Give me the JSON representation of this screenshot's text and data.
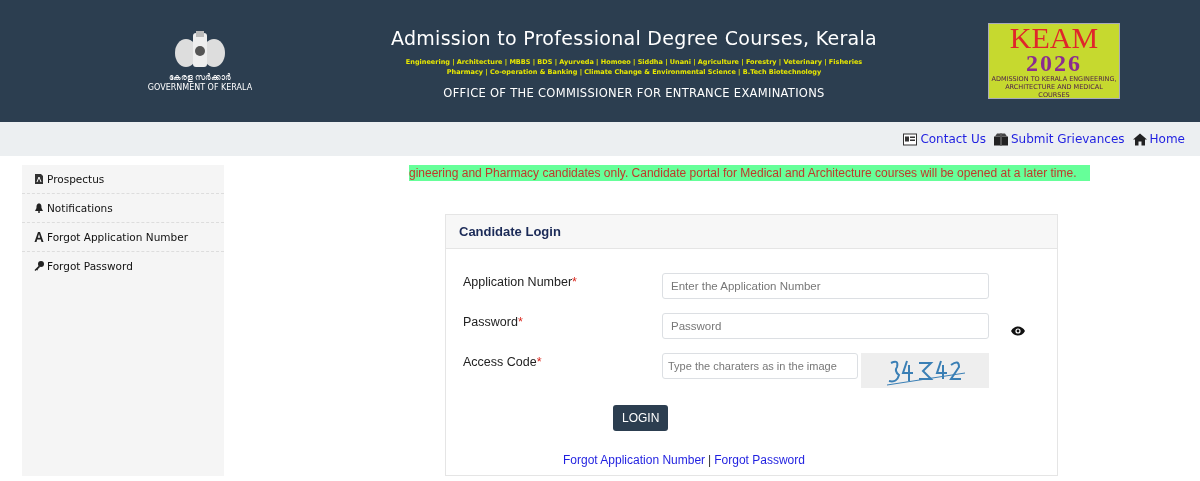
{
  "header": {
    "emblem_caption_ml": "കേരള സർക്കാർ",
    "emblem_caption": "GOVERNMENT OF KERALA",
    "title": "Admission to Professional Degree Courses, Kerala",
    "courses_line_1": "Engineering | Architecture | MBBS | BDS | Ayurveda | Homoeo | Siddha | Unani | Agriculture | Forestry | Veterinary | Fisheries",
    "courses_line_2": "Pharmacy | Co-operation & Banking | Climate Change & Environmental Science | B.Tech Biotechnology",
    "subtitle": "OFFICE OF THE COMMISSIONER FOR ENTRANCE EXAMINATIONS",
    "logo": {
      "name": "KEAM",
      "year": "2026",
      "caption": "ADMISSION TO KERALA ENGINEERING, ARCHITECTURE AND MEDICAL COURSES"
    }
  },
  "nav_links": [
    {
      "label": "Contact Us",
      "kind": "card"
    },
    {
      "label": "Submit Grievances",
      "kind": "box"
    },
    {
      "label": "Home",
      "kind": "home"
    }
  ],
  "sidebar": {
    "items": [
      {
        "label": "Prospectus",
        "kind": "doc"
      },
      {
        "label": "Notifications",
        "kind": "bell"
      },
      {
        "label": "Forgot Application Number",
        "kind": "letter"
      },
      {
        "label": "Forgot Password",
        "kind": "key"
      }
    ]
  },
  "marquee": "gineering and Pharmacy candidates only. Candidate portal for Medical and Architecture courses will be opened at a later time.",
  "login": {
    "title": "Candidate Login",
    "fields": [
      {
        "label": "Application Number",
        "required_mark": "*",
        "placeholder": "Enter the Application Number",
        "kind": "text"
      },
      {
        "label": "Password",
        "required_mark": "*",
        "placeholder": "Password",
        "kind": "password"
      },
      {
        "label": "Access Code",
        "required_mark": "*",
        "placeholder": "Type the charaters as in the image",
        "kind": "captcha"
      }
    ],
    "button": "LOGIN",
    "links": [
      {
        "label": "Forgot Application Number"
      },
      {
        "separator": "|",
        "label": "Forgot Password"
      }
    ]
  }
}
